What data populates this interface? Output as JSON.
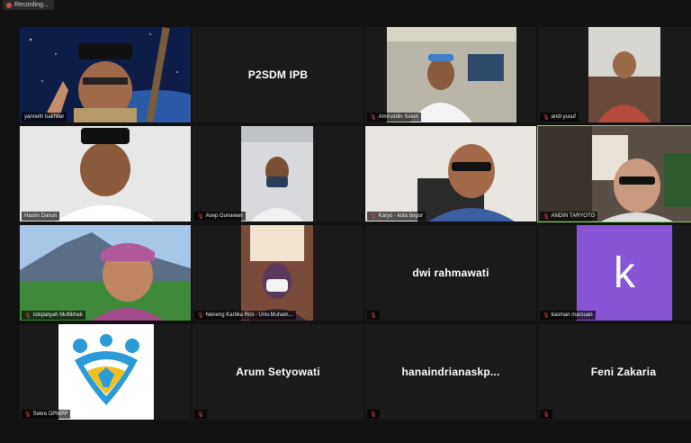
{
  "topbar": {
    "recording_label": "Recording..."
  },
  "participants": [
    {
      "name": "yannefri bakhtiar",
      "type": "video"
    },
    {
      "name": "P2SDM IPB",
      "type": "name_only"
    },
    {
      "name": "Amiruddin Saleh",
      "type": "video"
    },
    {
      "name": "andi yusuf",
      "type": "video"
    },
    {
      "name": "Hasim Danuri",
      "type": "video"
    },
    {
      "name": "Asep Gunawan",
      "type": "video"
    },
    {
      "name": "Karyo - kota bogor",
      "type": "video"
    },
    {
      "name": "ANDIN TARYOTO",
      "type": "video",
      "active_speaker": true
    },
    {
      "name": "Istiqlaliyah Muflikhati",
      "type": "video"
    },
    {
      "name": "Neneng Kartika Rini - Univ.Muham...",
      "type": "video"
    },
    {
      "name": "dwi rahmawati",
      "type": "name_only"
    },
    {
      "name": "kasman marsuan",
      "type": "avatar",
      "avatar_letter": "k"
    },
    {
      "name": "Sekre DPMPP",
      "type": "logo"
    },
    {
      "name": "Arum Setyowati",
      "type": "name_only"
    },
    {
      "name": "hanaindrianaskp...",
      "type": "name_only"
    },
    {
      "name": "Feni Zakaria",
      "type": "name_only"
    }
  ],
  "colors": {
    "active_border": "#7ed957",
    "avatar_bg": "#8756d6",
    "tile_bg": "#1a1a1a"
  },
  "icons": {
    "mic_muted": "muted-mic-icon"
  }
}
